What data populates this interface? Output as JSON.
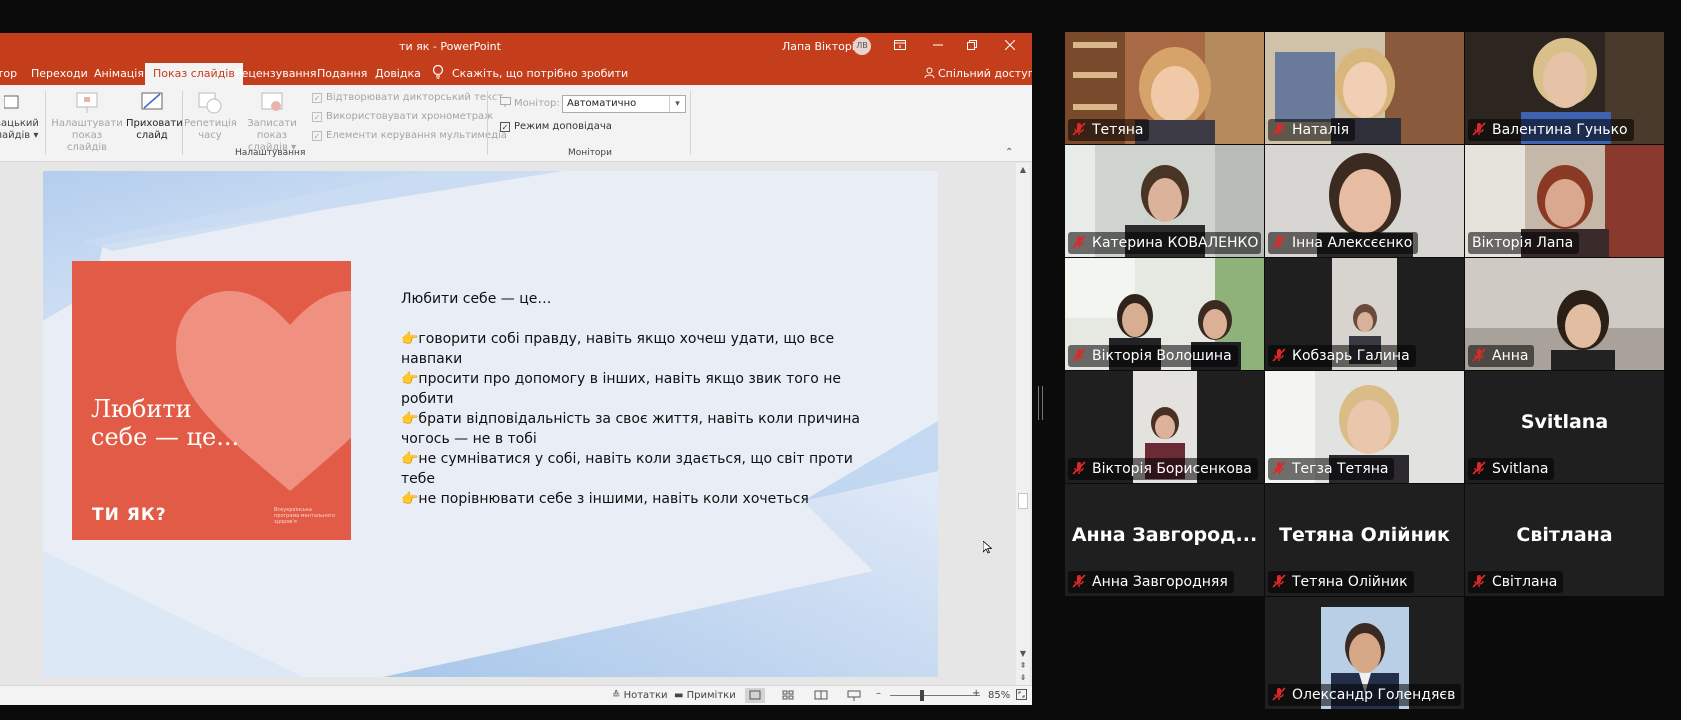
{
  "powerpoint": {
    "title": "ти як  -  PowerPoint",
    "user_name": "Лапа Вікторія",
    "user_initials": "ЛВ",
    "tabs": [
      "тор",
      "Переходи",
      "Анімація",
      "Показ слайдів",
      "Рецензування",
      "Подання",
      "Довідка"
    ],
    "active_tab": "Показ слайдів",
    "tell_me": "Скажіть, що потрібно зробити",
    "share": "Спільний доступ",
    "ribbon": {
      "custom_show_line1": "вацький",
      "custom_show_line2": "лайдів",
      "setup_show_line1": "Налаштувати",
      "setup_show_line2": "показ слайдів",
      "hide_slide_line1": "Приховати",
      "hide_slide_line2": "слайд",
      "rehearse_line1": "Репетиція",
      "rehearse_line2": "часу",
      "record_line1": "Записати показ",
      "record_line2": "слайдів",
      "check_narration": "Відтворювати дикторський текст",
      "check_timings": "Використовувати хронометраж",
      "check_media": "Елементи керування мультимедіа",
      "group_setup": "Налаштування",
      "monitor_label": "Монітор:",
      "monitor_value": "Автоматично",
      "presenter_view": "Режим доповідача",
      "group_monitors": "Монітори"
    },
    "slide": {
      "cover_title_line1": "Любити",
      "cover_title_line2": "себе — це...",
      "cover_brand": "ТИ ЯК?",
      "cover_sub": "Всеукраїнська програма ментального здоров'я",
      "heading": "Любити себе — це…",
      "points": [
        "👉говорити собі правду, навіть якщо хочеш удати, що все навпаки",
        "👉просити про допомогу в інших, навіть якщо звик того не робити",
        "👉брати відповідальність за своє життя, навіть коли причина чогось — не в тобі",
        "👉не сумніватися у собі, навіть коли здається, що світ проти тебе",
        "👉не порівнювати себе з іншими, навіть коли хочеться"
      ]
    },
    "statusbar": {
      "notes": "Нотатки",
      "comments": "Примітки",
      "zoom": "85%"
    }
  },
  "gallery": {
    "colors": {
      "speaking": "#23d959",
      "mic_muted": "#e02828"
    },
    "participants": [
      {
        "name": "Тетяна"
      },
      {
        "name": "Наталія"
      },
      {
        "name": "Валентина Гунько"
      },
      {
        "name": "Катерина КОВАЛЕНКО"
      },
      {
        "name": "Інна Алексєєнко"
      },
      {
        "name": "Вікторія Лапа"
      },
      {
        "name": "Вікторія Волошина"
      },
      {
        "name": "Кобзарь Галина"
      },
      {
        "name": "Анна"
      },
      {
        "name": "Вікторія Борисенкова"
      },
      {
        "name": "Тегза Тетяна"
      },
      {
        "name": "Svitlana",
        "big_label": "Svitlana"
      },
      {
        "name": "Анна Завгородняя",
        "big_label": "Анна Завгород..."
      },
      {
        "name": "Тетяна Олійник",
        "big_label": "Тетяна Олійник"
      },
      {
        "name": "Світлана",
        "big_label": "Світлана"
      },
      {
        "name": "Олександр Голендяєв"
      }
    ]
  }
}
